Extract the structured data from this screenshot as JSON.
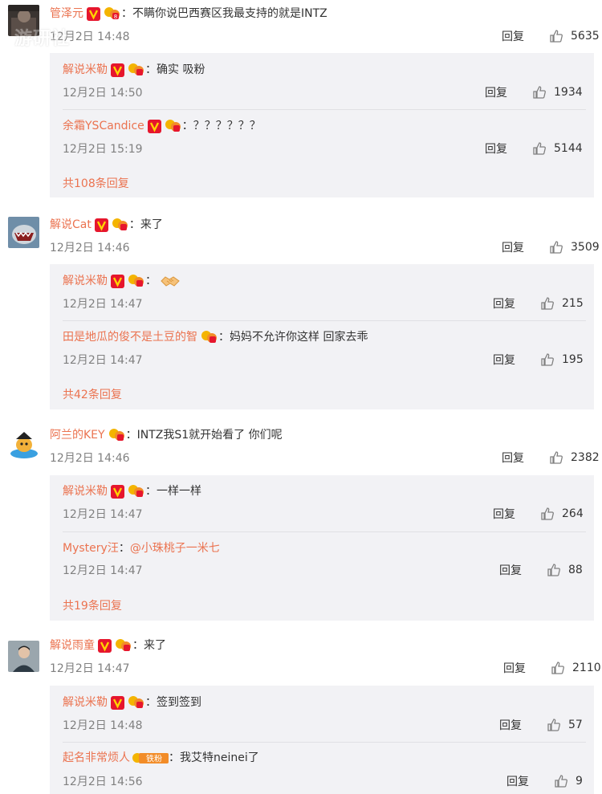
{
  "colors": {
    "accent": "#eb7350",
    "sub_bg": "#f2f2f5",
    "badge_red": "#e6162d",
    "badge_gold": "#f4b400"
  },
  "watermark": "游研社",
  "icons": {
    "verified": "verified-v-badge-icon",
    "level": "fan-level-badge-icon",
    "fan": "iron-fan-badge-icon",
    "like": "thumbs-up-icon"
  },
  "reply_label": "回复",
  "comments": [
    {
      "user": "管泽元",
      "text": "不瞒你说巴西赛区我最支持的就是INTZ",
      "time": "12月2日 14:48",
      "likes": "5635",
      "replies": [
        {
          "user": "解说米勒",
          "text": "确实 吸粉",
          "time": "12月2日 14:50",
          "likes": "1934"
        },
        {
          "user": "余霜YSCandice",
          "text": "？？？？？？",
          "time": "12月2日 15:19",
          "likes": "5144"
        }
      ],
      "more": "共108条回复"
    },
    {
      "user": "解说Cat",
      "text": "来了",
      "time": "12月2日 14:46",
      "likes": "3509",
      "replies": [
        {
          "user": "解说米勒",
          "text": "",
          "emoji": "handshake",
          "time": "12月2日 14:47",
          "likes": "215"
        },
        {
          "user": "田是地瓜的俊不是土豆的智",
          "text": "妈妈不允许你这样 回家去乖",
          "time": "12月2日 14:47",
          "likes": "195"
        }
      ],
      "more": "共42条回复"
    },
    {
      "user": "阿兰的KEY",
      "text": "INTZ我S1就开始看了 你们呢",
      "time": "12月2日 14:46",
      "likes": "2382",
      "replies": [
        {
          "user": "解说米勒",
          "text": "一样一样",
          "time": "12月2日 14:47",
          "likes": "264"
        },
        {
          "user": "Mystery汪",
          "text": "",
          "mention": "@小珠桃子一米七",
          "time": "12月2日 14:47",
          "likes": "88"
        }
      ],
      "more": "共19条回复"
    },
    {
      "user": "解说雨童",
      "text": "来了",
      "time": "12月2日 14:47",
      "likes": "2110",
      "replies": [
        {
          "user": "解说米勒",
          "text": "签到签到",
          "time": "12月2日 14:48",
          "likes": "57"
        },
        {
          "user": "起名非常烦人",
          "fan_label": "铁粉",
          "text": "我艾特neinei了",
          "time": "12月2日 14:56",
          "likes": "9"
        }
      ]
    }
  ]
}
